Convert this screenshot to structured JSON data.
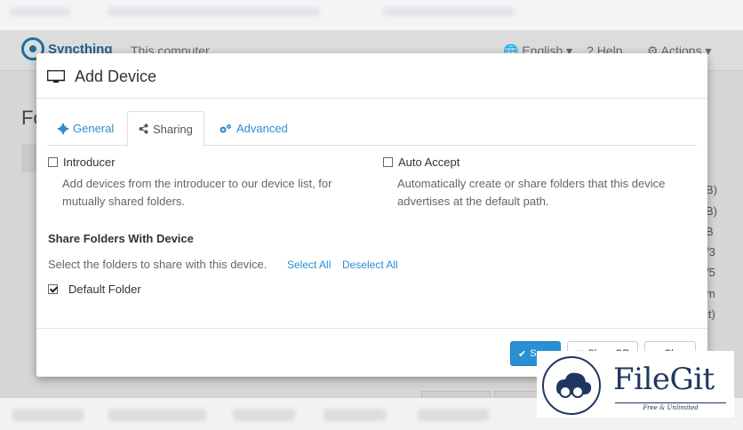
{
  "background": {
    "brand": "Syncthing",
    "device": "This computer",
    "nav": {
      "language": "English",
      "help": "Help",
      "actions": "Actions"
    },
    "heading": "Fo",
    "right_col": [
      "B)",
      "B)",
      "B",
      "/3",
      "/5",
      "m",
      "it)"
    ]
  },
  "modal": {
    "title": "Add Device",
    "tabs": [
      {
        "label": "General",
        "icon": "gear-icon"
      },
      {
        "label": "Sharing",
        "icon": "share-icon"
      },
      {
        "label": "Advanced",
        "icon": "cogs-icon"
      }
    ],
    "active_tab": "Sharing",
    "introducer": {
      "label": "Introducer",
      "checked": false,
      "help_line1": "Add devices from the introducer to our device list, for",
      "help_line2": "mutually shared folders."
    },
    "auto_accept": {
      "label": "Auto Accept",
      "checked": false,
      "help_line1": "Automatically create or share folders that this device",
      "help_line2": "advertises at the default path."
    },
    "share": {
      "title": "Share Folders With Device",
      "description": "Select the folders to share with this device.",
      "select_all": "Select All",
      "deselect_all": "Deselect All",
      "folders": [
        {
          "label": "Default Folder",
          "checked": true
        }
      ]
    },
    "footer": {
      "save": "S",
      "show_qr": "Show QR",
      "close": "Close"
    }
  },
  "watermark": {
    "name": "FileGit",
    "tagline": "Free & Unlimited"
  },
  "colors": {
    "accent": "#2a8fd3",
    "brand": "#1f5f8a",
    "watermark": "#1f3760"
  }
}
